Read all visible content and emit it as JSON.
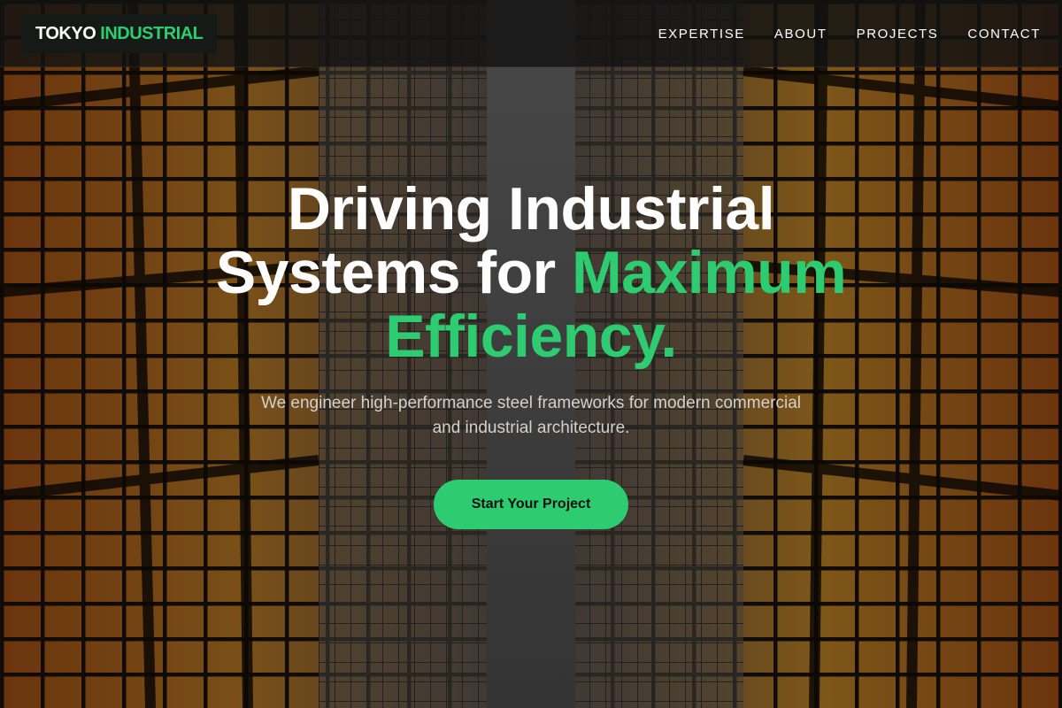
{
  "brand": {
    "name": "TOKYO",
    "accent": "INDUSTRIAL"
  },
  "nav": [
    "EXPERTISE",
    "ABOUT",
    "PROJECTS",
    "CONTACT"
  ],
  "hero": {
    "line1": "Driving Industrial",
    "line2_plain": "Systems for",
    "line2_accent": "Maximum",
    "line3_accent": "Efficiency.",
    "subtitle": "We engineer high-performance steel frameworks for modern commercial and industrial architecture.",
    "cta_label": "Start Your Project"
  },
  "colors": {
    "accent": "#2ecc71",
    "nav_bg": "#121212",
    "text": "#ffffff"
  }
}
